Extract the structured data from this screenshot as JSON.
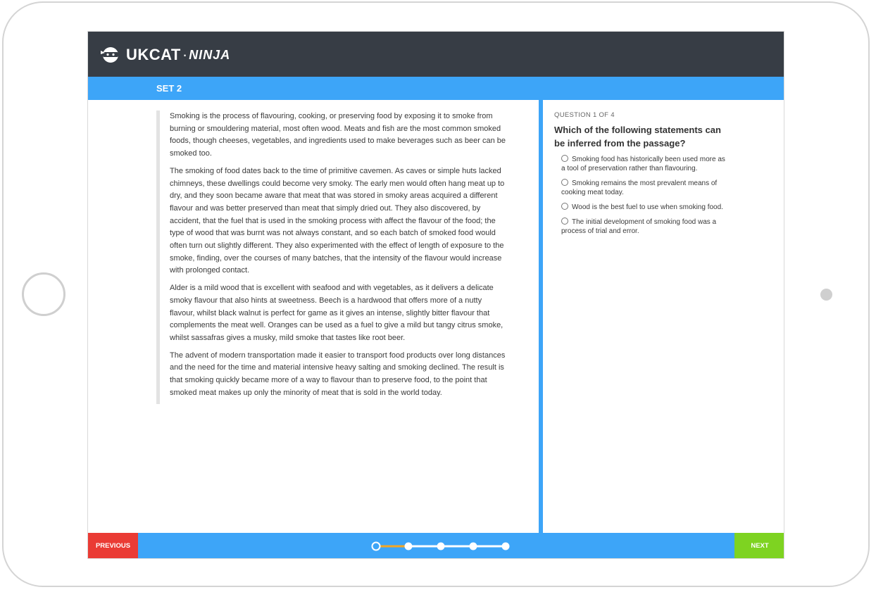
{
  "app": {
    "logo_main": "UKCAT",
    "logo_sep": "·",
    "logo_sub": "NINJA",
    "set_title": "SET 2"
  },
  "passage": {
    "paragraphs": [
      "Smoking is the process of flavouring, cooking, or preserving food by exposing it to smoke from burning or smouldering material, most often wood. Meats and fish are the most common smoked foods, though cheeses, vegetables, and ingredients used to make beverages such as beer can be smoked too.",
      "The smoking of food dates back to the time of primitive cavemen. As caves or simple huts lacked chimneys, these dwellings could become very smoky. The early men would often hang meat up to dry, and they soon became aware that meat that was stored in smoky areas acquired a different flavour and was better preserved than meat that simply dried out. They also discovered, by accident, that the fuel that is used in the smoking process with affect the flavour of the food; the type of wood that was burnt was not always constant, and so each batch of smoked food would often turn out slightly different. They also experimented with the effect of length of exposure to the smoke, finding, over the courses of many batches, that the intensity of the flavour would increase with prolonged contact.",
      "Alder is a mild wood that is excellent with seafood and with vegetables, as it delivers a delicate smoky flavour that also hints at sweetness. Beech is a hardwood that offers more of a nutty flavour, whilst black walnut is perfect for game as it gives an intense, slightly bitter flavour that complements the meat well. Oranges can be used as a fuel to give a mild but tangy citrus smoke, whilst sassafras gives a musky, mild smoke that tastes like root beer.",
      "The advent of modern transportation made it easier to transport food products over long distances and the need for the time and material intensive heavy salting and smoking declined. The result is that smoking quickly became more of a way to flavour than to preserve food, to the point that smoked meat makes up only the minority of meat that is sold in the world today."
    ]
  },
  "question": {
    "counter": "QUESTION 1 OF 4",
    "text": "Which of the following statements can be inferred from the passage?",
    "options": [
      "Smoking food has historically been used more as a tool of preservation rather than flavouring.",
      "Smoking remains the most prevalent means of cooking meat today.",
      "Wood is the best fuel to use when smoking food.",
      "The initial development of smoking food was a process of trial and error."
    ]
  },
  "nav": {
    "previous_label": "PREVIOUS",
    "next_label": "NEXT",
    "progress": {
      "current": 1,
      "total": 5
    }
  },
  "colors": {
    "topbar": "#373d45",
    "accent_blue": "#3da5f8",
    "previous_red": "#ea3b34",
    "next_green": "#7ed321",
    "progress_orange": "#f5a623"
  },
  "icons": {
    "logo": "ninja-head-icon",
    "radio": "radio-unchecked-icon"
  }
}
